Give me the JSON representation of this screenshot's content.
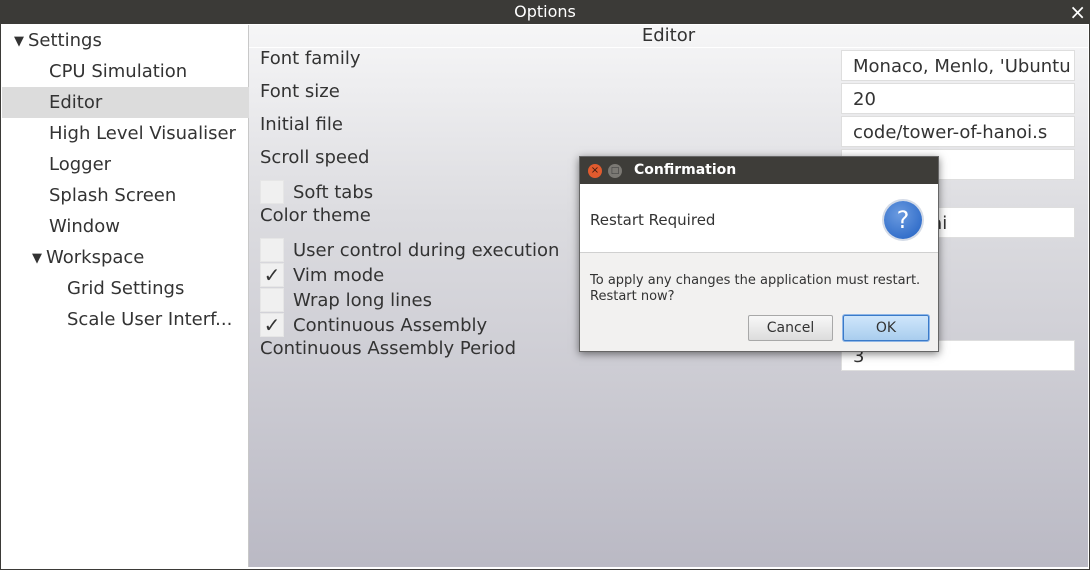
{
  "window": {
    "title": "Options"
  },
  "sidebar": {
    "items": [
      {
        "label": "Settings",
        "expanded": true
      },
      {
        "label": "CPU Simulation"
      },
      {
        "label": "Editor",
        "selected": true
      },
      {
        "label": "High Level Visualiser"
      },
      {
        "label": "Logger"
      },
      {
        "label": "Splash Screen"
      },
      {
        "label": "Window"
      },
      {
        "label": "Workspace",
        "expanded": true
      },
      {
        "label": "Grid Settings"
      },
      {
        "label": "Scale User Interf..."
      }
    ]
  },
  "editor": {
    "title": "Editor",
    "font_family": {
      "label": "Font family",
      "value": "Monaco, Menlo, 'Ubuntu"
    },
    "font_size": {
      "label": "Font size",
      "value": "20"
    },
    "initial_file": {
      "label": "Initial file",
      "value": "code/tower-of-hanoi.s"
    },
    "scroll_speed": {
      "label": "Scroll speed",
      "value": ""
    },
    "soft_tabs": {
      "label": "Soft tabs",
      "checked": false
    },
    "color_theme": {
      "label": "Color theme",
      "value": "e/monokai"
    },
    "user_control": {
      "label": "User control during execution",
      "checked": false
    },
    "vim_mode": {
      "label": "Vim mode",
      "checked": true
    },
    "wrap_lines": {
      "label": "Wrap long lines",
      "checked": false
    },
    "continuous_assembly": {
      "label": "Continuous Assembly",
      "checked": true
    },
    "continuous_period": {
      "label": "Continuous Assembly Period",
      "value": "3"
    }
  },
  "dialog": {
    "title": "Confirmation",
    "heading": "Restart Required",
    "message_line1": "To apply any changes the application must restart.",
    "message_line2": "Restart now?",
    "cancel_label": "Cancel",
    "ok_label": "OK",
    "icon": "question-icon",
    "icon_glyph": "?"
  },
  "icons": {
    "close": "×",
    "check": "✓",
    "arrow_down": "▼",
    "dlg_close": "×",
    "dlg_min": "□"
  }
}
